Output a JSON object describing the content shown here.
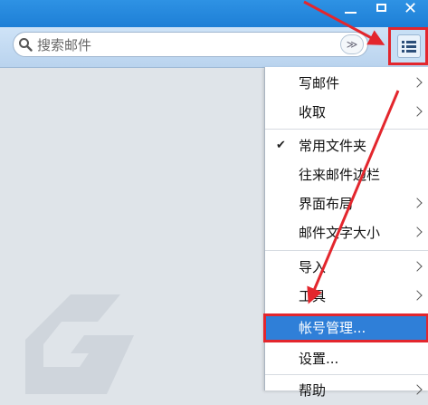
{
  "window": {
    "minimize_icon": "minimize-icon",
    "maximize_icon": "maximize-icon",
    "close_glyph": "✕"
  },
  "search": {
    "placeholder": "搜索邮件",
    "dropdown_glyph": "≫"
  },
  "menu": {
    "items": [
      {
        "label": "写邮件",
        "submenu": true
      },
      {
        "label": "收取",
        "submenu": true
      },
      {
        "label": "常用文件夹",
        "checked": true,
        "submenu": false
      },
      {
        "label": "往来邮件边栏",
        "submenu": false
      },
      {
        "label": "界面布局",
        "submenu": true
      },
      {
        "label": "邮件文字大小",
        "submenu": true
      },
      {
        "label": "导入",
        "submenu": true
      },
      {
        "label": "工具",
        "submenu": true
      },
      {
        "label": "帐号管理...",
        "submenu": false,
        "highlighted": true
      },
      {
        "label": "设置...",
        "submenu": false
      },
      {
        "label": "帮助",
        "submenu": true
      }
    ],
    "check_glyph": "✔"
  },
  "colors": {
    "titlebar": "#1e7fd6",
    "highlight": "#2f7fd8",
    "annotation_red": "#e3262d"
  }
}
